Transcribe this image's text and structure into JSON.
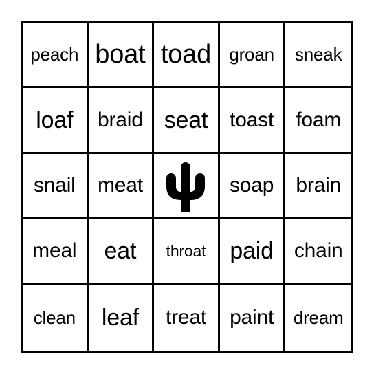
{
  "card": {
    "type": "bingo-card",
    "grid_size": "5x5",
    "border_color": "#000000",
    "background_color": "#ffffff",
    "text_color": "#000000",
    "free_space": {
      "position": "center",
      "row": 3,
      "column": 3,
      "icon": "cactus-icon",
      "icon_color": "#000000"
    },
    "rows": [
      [
        {
          "label": "peach",
          "size": "sm"
        },
        {
          "label": "boat",
          "size": "xl"
        },
        {
          "label": "toad",
          "size": "xl"
        },
        {
          "label": "groan",
          "size": "sm"
        },
        {
          "label": "sneak",
          "size": "sm"
        }
      ],
      [
        {
          "label": "loaf",
          "size": "lg"
        },
        {
          "label": "braid",
          "size": "md"
        },
        {
          "label": "seat",
          "size": "lg"
        },
        {
          "label": "toast",
          "size": "md"
        },
        {
          "label": "foam",
          "size": "md"
        }
      ],
      [
        {
          "label": "snail",
          "size": "md"
        },
        {
          "label": "meat",
          "size": "md"
        },
        {
          "label": "",
          "size": "md",
          "free": true,
          "icon": "cactus-icon"
        },
        {
          "label": "soap",
          "size": "md"
        },
        {
          "label": "brain",
          "size": "md"
        }
      ],
      [
        {
          "label": "meal",
          "size": "md"
        },
        {
          "label": "eat",
          "size": "lg"
        },
        {
          "label": "throat",
          "size": "xs"
        },
        {
          "label": "paid",
          "size": "lg"
        },
        {
          "label": "chain",
          "size": "md"
        }
      ],
      [
        {
          "label": "clean",
          "size": "sm"
        },
        {
          "label": "leaf",
          "size": "lg"
        },
        {
          "label": "treat",
          "size": "md"
        },
        {
          "label": "paint",
          "size": "md"
        },
        {
          "label": "dream",
          "size": "sm"
        }
      ]
    ]
  }
}
